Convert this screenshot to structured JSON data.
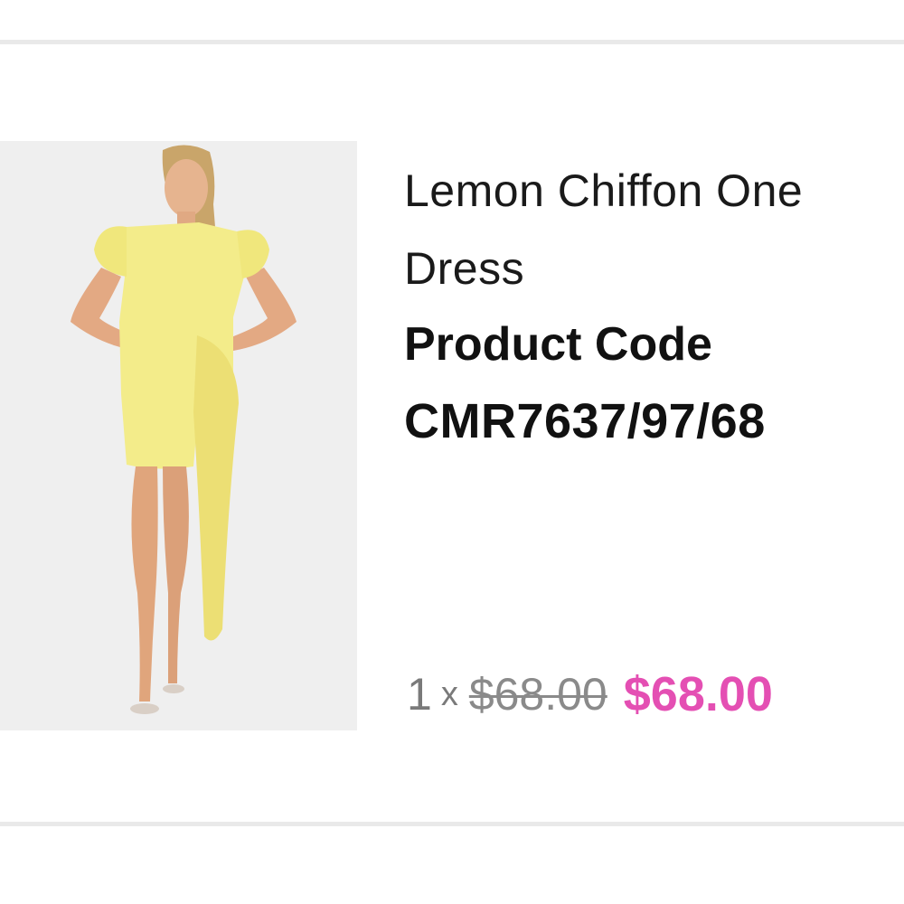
{
  "product": {
    "name": "Lemon Chiffon One Dress",
    "code_label": "Product Code",
    "code_value": "CMR7637/97/68",
    "image_alt": "Lemon Chiffon One Dress",
    "quantity": "1",
    "times": "x",
    "original_price": "$68.00",
    "sale_price": "$68.00"
  },
  "colors": {
    "sale_price": "#e44fb3",
    "original_price": "#8a8a8a",
    "dress": "#f3ec8a",
    "image_background": "#efefef",
    "divider": "#e9e9e9"
  }
}
